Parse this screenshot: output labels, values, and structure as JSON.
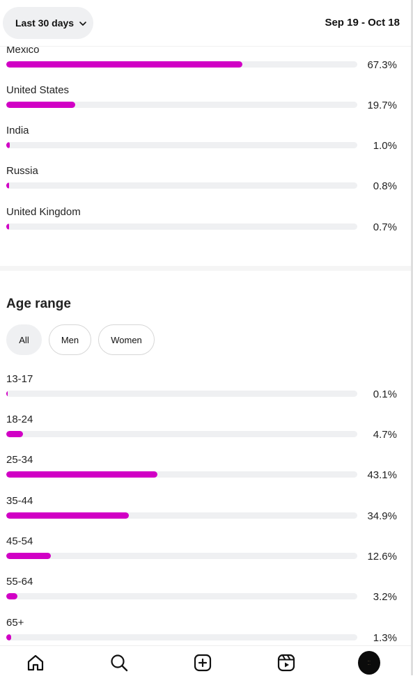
{
  "header": {
    "range_label": "Last 30 days",
    "date_range": "Sep 19 - Oct 18"
  },
  "countries": [
    {
      "label": "Mexico",
      "percent_text": "67.3%",
      "value": 67.3
    },
    {
      "label": "United States",
      "percent_text": "19.7%",
      "value": 19.7
    },
    {
      "label": "India",
      "percent_text": "1.0%",
      "value": 1.0
    },
    {
      "label": "Russia",
      "percent_text": "0.8%",
      "value": 0.8
    },
    {
      "label": "United Kingdom",
      "percent_text": "0.7%",
      "value": 0.7
    }
  ],
  "age_range": {
    "title": "Age range",
    "filters": [
      "All",
      "Men",
      "Women"
    ],
    "selected_filter": "All",
    "items": [
      {
        "label": "13-17",
        "percent_text": "0.1%",
        "value": 0.1
      },
      {
        "label": "18-24",
        "percent_text": "4.7%",
        "value": 4.7
      },
      {
        "label": "25-34",
        "percent_text": "43.1%",
        "value": 43.1
      },
      {
        "label": "35-44",
        "percent_text": "34.9%",
        "value": 34.9
      },
      {
        "label": "45-54",
        "percent_text": "12.6%",
        "value": 12.6
      },
      {
        "label": "55-64",
        "percent_text": "3.2%",
        "value": 3.2
      },
      {
        "label": "65+",
        "percent_text": "1.3%",
        "value": 1.3
      }
    ]
  },
  "nav": {
    "items": [
      "home-icon",
      "search-icon",
      "create-icon",
      "reels-icon",
      "profile-avatar"
    ]
  },
  "colors": {
    "bar_fill": "#d100c5",
    "bar_track": "#eff0f2"
  }
}
